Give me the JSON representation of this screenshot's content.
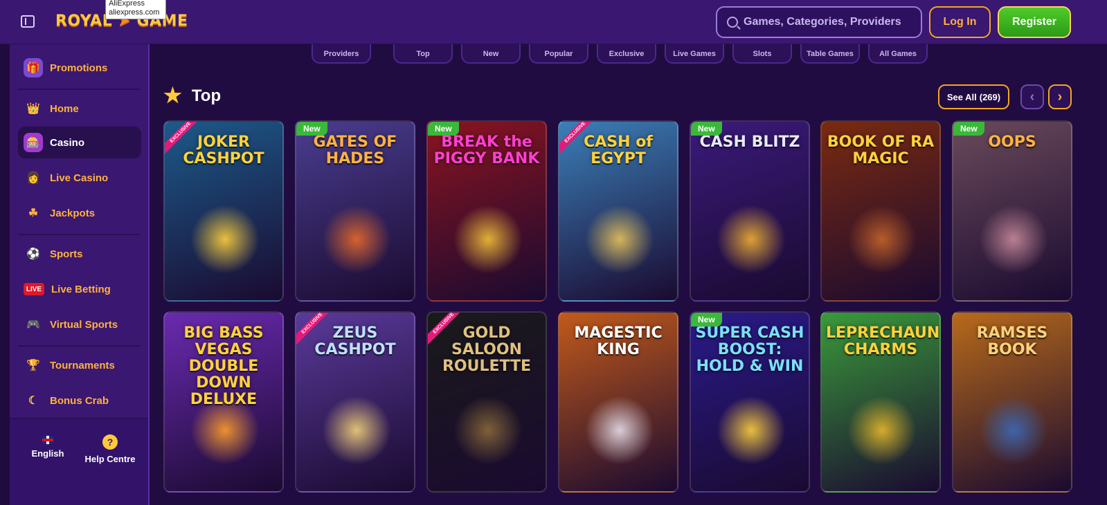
{
  "tooltip": {
    "line1": "AliExpress",
    "line2": "aliexpress.com"
  },
  "header": {
    "logo_left": "ROYAL",
    "logo_right": "GAME",
    "search_placeholder": "Games, Categories, Providers",
    "login_label": "Log In",
    "register_label": "Register"
  },
  "sidebar": {
    "items": [
      {
        "label": "Promotions",
        "icon": "gift-icon"
      },
      {
        "label": "Home",
        "icon": "crown-icon"
      },
      {
        "label": "Casino",
        "icon": "slot-machine-icon"
      },
      {
        "label": "Live Casino",
        "icon": "dealer-icon"
      },
      {
        "label": "Jackpots",
        "icon": "clover-icon"
      },
      {
        "label": "Sports",
        "icon": "ball-icon"
      },
      {
        "label": "Live Betting",
        "icon": "live-icon"
      },
      {
        "label": "Virtual Sports",
        "icon": "gamepad-icon"
      },
      {
        "label": "Tournaments",
        "icon": "trophy-icon"
      },
      {
        "label": "Bonus Crab",
        "icon": "crab-claw-icon"
      }
    ],
    "live_badge": "LIVE",
    "language_label": "English",
    "help_label": "Help Centre",
    "help_glyph": "?"
  },
  "categories": [
    "Providers",
    "Top",
    "New",
    "Popular",
    "Exclusive",
    "Live Games",
    "Slots",
    "Table Games",
    "All Games"
  ],
  "section": {
    "title": "Top",
    "see_all_label": "See All",
    "see_all_count": "(269)",
    "prev_glyph": "‹",
    "next_glyph": "›"
  },
  "badges": {
    "new": "New",
    "exclusive": "EXCLUSIVE"
  },
  "games": [
    {
      "title": "JOKER CASHPOT",
      "badge": "exclusive",
      "bg": "#1c5a8a",
      "accent": "#ffd23c",
      "title_color": "#ffd23c"
    },
    {
      "title": "GATES OF HADES",
      "badge": "new",
      "bg": "#4a3d8f",
      "accent": "#e86a2a",
      "title_color": "#ffb340"
    },
    {
      "title": "BREAK the PIGGY BANK",
      "badge": "new",
      "bg": "#8a1420",
      "accent": "#f2c13a",
      "title_color": "#ff3fd0"
    },
    {
      "title": "CASH of EGYPT",
      "badge": "exclusive",
      "bg": "#3b7fb8",
      "accent": "#e7c45b",
      "title_color": "#ffd23c"
    },
    {
      "title": "CASH BLITZ",
      "badge": "new",
      "bg": "#3a1a7a",
      "accent": "#f0b232",
      "title_color": "#e8e8ff"
    },
    {
      "title": "BOOK OF RA MAGIC",
      "badge": "",
      "bg": "#7a2a10",
      "accent": "#c4652a",
      "title_color": "#ffd23c"
    },
    {
      "title": "OOPS",
      "badge": "new",
      "bg": "#6a4a5a",
      "accent": "#c88a9a",
      "title_color": "#ffb340"
    },
    {
      "title": "BIG BASS VEGAS DOUBLE DOWN DELUXE",
      "badge": "",
      "bg": "#6a2ab0",
      "accent": "#ff9f2a",
      "title_color": "#ffd23c"
    },
    {
      "title": "ZEUS CASHPOT",
      "badge": "exclusive",
      "bg": "#5a3a9a",
      "accent": "#f2d27a",
      "title_color": "#bfe0ff"
    },
    {
      "title": "GOLD SALOON ROULETTE",
      "badge": "exclusive",
      "bg": "#1a1a1a",
      "accent": "#8a6a3a",
      "title_color": "#e0c080"
    },
    {
      "title": "MAGESTIC KING",
      "badge": "",
      "bg": "#c25a1a",
      "accent": "#e8e0ea",
      "title_color": "#ffffff"
    },
    {
      "title": "SUPER CASH BOOST: HOLD & WIN",
      "badge": "new",
      "bg": "#2a1a8a",
      "accent": "#ffd23c",
      "title_color": "#7ae0ff"
    },
    {
      "title": "LEPRECHAUN CHARMS",
      "badge": "",
      "bg": "#3a9a3a",
      "accent": "#e8b82a",
      "title_color": "#ffd23c"
    },
    {
      "title": "RAMSES BOOK",
      "badge": "",
      "bg": "#b86a1a",
      "accent": "#3a6ab8",
      "title_color": "#ffd27a"
    }
  ]
}
